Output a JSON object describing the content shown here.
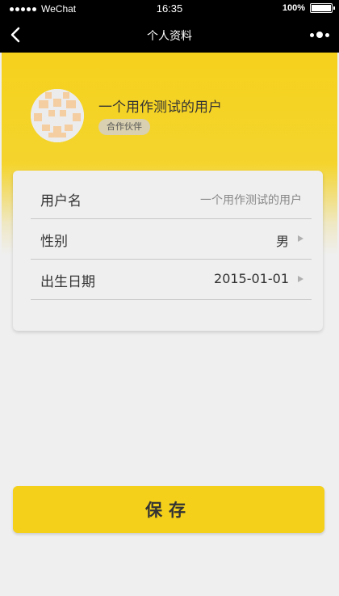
{
  "status_bar": {
    "carrier": "WeChat",
    "time": "16:35",
    "battery": "100%"
  },
  "nav": {
    "title": "个人资料",
    "back_icon": "chevron-left-icon",
    "more_icon": "more-dots-icon"
  },
  "profile": {
    "nickname": "一个用作测试的用户",
    "badge": "合作伙伴"
  },
  "form": {
    "rows": [
      {
        "label": "用户名",
        "value": "一个用作测试的用户"
      },
      {
        "label": "性别",
        "value": "男"
      },
      {
        "label": "出生日期",
        "value": "2015-01-01"
      }
    ]
  },
  "save_button": {
    "label": "保存"
  },
  "colors": {
    "accent": "#f4d01a",
    "nav_bg": "#000000",
    "page_bg": "#efefef"
  }
}
